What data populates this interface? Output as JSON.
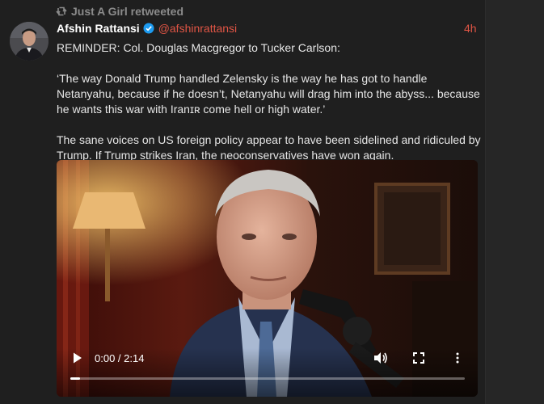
{
  "retweet": {
    "label": "Just A Girl retweeted",
    "icon": "retweet-icon"
  },
  "tweet": {
    "author_name": "Afshin Rattansi",
    "verified": true,
    "handle": "@afshinrattansi",
    "timestamp": "4h",
    "paragraphs": [
      "REMINDER: Col. Douglas Macgregor to Tucker Carlson:",
      "‘The way Donald Trump handled Zelensky is the way he has got to handle Netanyahu, because if he doesn’t, Netanyahu will drag him into the abyss... because he wants this war with Iranɪʀ come hell or high water.’",
      "The sane voices on US foreign policy appear to have been sidelined and ridiculed by Trump. If Trump strikes Iran, the neoconservatives have won again."
    ]
  },
  "video": {
    "time_display": "0:00 / 2:14",
    "progress": 0.025,
    "play_icon": "play-icon",
    "volume_icon": "volume-icon",
    "fullscreen_icon": "fullscreen-icon",
    "menu_icon": "more-options-icon"
  },
  "colors": {
    "accent": "#e05545",
    "background": "#1f1f1f",
    "verified": "#1d9bf0"
  }
}
